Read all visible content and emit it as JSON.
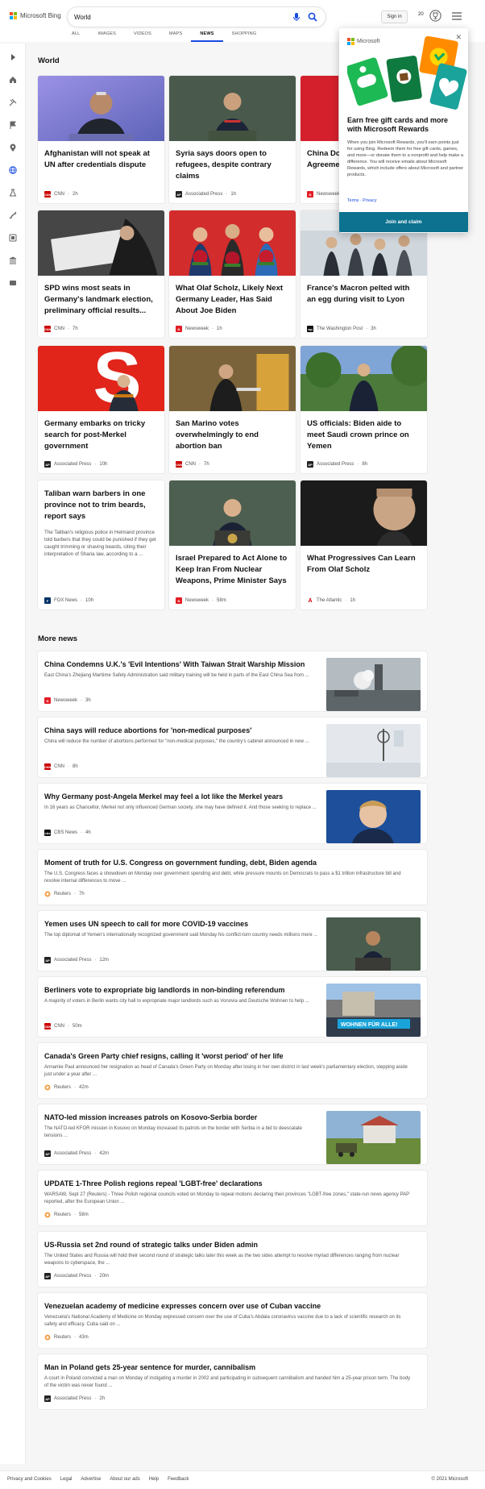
{
  "header": {
    "brand": "Microsoft Bing",
    "query": "World",
    "signin": "Sign in",
    "points": "20"
  },
  "tabs": [
    "ALL",
    "IMAGES",
    "VIDEOS",
    "MAPS",
    "NEWS",
    "SHOPPING"
  ],
  "active_tab": "NEWS",
  "section_world": "World",
  "section_more": "More news",
  "popup": {
    "brand": "Microsoft",
    "headline": "Earn free gift cards and more with Microsoft Rewards",
    "body": "When you join Microsoft Rewards, you'll earn points just for using Bing. Redeem them for free gift cards, games, and more—or donate them to a nonprofit and help make a difference. You will receive emails about Microsoft Rewards, which include offers about Microsoft and partner products.",
    "terms": "Terms",
    "privacy": "Privacy",
    "cta": "Join and claim"
  },
  "cards": [
    {
      "title": "Afghanistan will not speak at UN after credentials dispute",
      "source": "CNN",
      "time": "2h",
      "logo": "cnn",
      "img": "afghan"
    },
    {
      "title": "Syria says doors open to refugees, despite contrary claims",
      "source": "Associated Press",
      "time": "1h",
      "logo": "ap",
      "img": "syria"
    },
    {
      "title": "China Do... Prisoner... Agreeme...",
      "source": "Newsweek",
      "time": "",
      "logo": "nw",
      "img": "china"
    },
    {
      "title": "SPD wins most seats in Germany's landmark election, preliminary official results...",
      "source": "CNN",
      "time": "7h",
      "logo": "cnn",
      "img": "vote"
    },
    {
      "title": "What Olaf Scholz, Likely Next Germany Leader, Has Said About Joe Biden",
      "source": "Newsweek",
      "time": "1h",
      "logo": "nw",
      "img": "flowers"
    },
    {
      "title": "France's Macron pelted with an egg during visit to Lyon",
      "source": "The Washington Post",
      "time": "3h",
      "logo": "wp",
      "img": "macron"
    },
    {
      "title": "Germany embarks on tricky search for post-Merkel government",
      "source": "Associated Press",
      "time": "10h",
      "logo": "ap",
      "img": "spd"
    },
    {
      "title": "San Marino votes overwhelmingly to end abortion ban",
      "source": "CNN",
      "time": "7h",
      "logo": "cnn",
      "img": "sanmarino"
    },
    {
      "title": "US officials: Biden aide to meet Saudi crown prince on Yemen",
      "source": "Associated Press",
      "time": "8h",
      "logo": "ap",
      "img": "biden"
    },
    {
      "title": "Taliban warn barbers in one province not to trim beards, report says",
      "desc": "The Taliban's religious police in Helmand province told barbers that they could be punished if they get caught trimming or shaving beards, citing their interpretation of Sharia law, according to a ...",
      "source": "FOX News",
      "time": "10h",
      "logo": "fox",
      "img": ""
    },
    {
      "title": "Israel Prepared to Act Alone to Keep Iran From Nuclear Weapons, Prime Minister Says",
      "source": "Newsweek",
      "time": "58m",
      "logo": "nw",
      "img": "israel"
    },
    {
      "title": "What Progressives Can Learn From Olaf Scholz",
      "source": "The Atlantic",
      "time": "1h",
      "logo": "atl",
      "img": "scholz"
    }
  ],
  "more": [
    {
      "title": "China Condemns U.K.'s 'Evil Intentions' With Taiwan Strait Warship Mission",
      "desc": "East China's Zhejiang Maritime Safety Administration said military training will be held in parts of the East China Sea from ...",
      "source": "Newsweek",
      "time": "3h",
      "logo": "nw",
      "img": "ship"
    },
    {
      "title": "China says will reduce abortions for 'non-medical purposes'",
      "desc": "China will reduce the number of abortions performed for \"non-medical purposes,\" the country's cabinet announced in new ...",
      "source": "CNN",
      "time": "8h",
      "logo": "cnn",
      "img": "clinic"
    },
    {
      "title": "Why Germany post-Angela Merkel may feel a lot like the Merkel years",
      "desc": "In 16 years as Chancellor, Merkel not only influenced German society, she may have defined it. And those seeking to replace ...",
      "source": "CBS News",
      "time": "4h",
      "logo": "cbs",
      "img": "merkel"
    },
    {
      "title": "Moment of truth for U.S. Congress on government funding, debt, Biden agenda",
      "desc": "The U.S. Congress faces a showdown on Monday over government spending and debt, while pressure mounts on Democrats to pass a $1 trillion infrastructure bill and resolve internal differences to move ...",
      "source": "Reuters",
      "time": "7h",
      "logo": "reu",
      "img": ""
    },
    {
      "title": "Yemen uses UN speech to call for more COVID-19 vaccines",
      "desc": "The top diplomat of Yemen's internationally recognized government said Monday his conflict-torn country needs millions more ...",
      "source": "Associated Press",
      "time": "12m",
      "logo": "ap",
      "img": "yemen"
    },
    {
      "title": "Berliners vote to expropriate big landlords in non-binding referendum",
      "desc": "A majority of voters in Berlin wants city hall to expropriate major landlords such as Vonovia and Deutsche Wohnen to help ...",
      "source": "CNN",
      "time": "50m",
      "logo": "cnn",
      "img": "berlin",
      "banner": "WOHNEN FÜR ALLE!"
    },
    {
      "title": "Canada's Green Party chief resigns, calling it 'worst period' of her life",
      "desc": "Annamie Paul announced her resignation as head of Canada's Green Party on Monday after losing in her own district in last week's parliamentary election, stepping aside just under a year after ...",
      "source": "Reuters",
      "time": "42m",
      "logo": "reu",
      "img": ""
    },
    {
      "title": "NATO-led mission increases patrols on Kosovo-Serbia border",
      "desc": "The NATO-led KFOR mission in Kosovo on Monday increased its patrols on the border with Serbia in a bid to deescalate tensions ...",
      "source": "Associated Press",
      "time": "42m",
      "logo": "ap",
      "img": "kosovo"
    },
    {
      "title": "UPDATE 1-Three Polish regions repeal 'LGBT-free' declarations",
      "desc": "WARSAW, Sept 27 (Reuters) - Three Polish regional councils voted on Monday to repeal motions declaring their provinces \"LGBT-free zones,\" state-run news agency PAP reported, after the European Union ...",
      "source": "Reuters",
      "time": "58m",
      "logo": "reu",
      "img": ""
    },
    {
      "title": "US-Russia set 2nd round of strategic talks under Biden admin",
      "desc": "The United States and Russia will hold their second round of strategic talks later this week as the two sides attempt to resolve myriad differences ranging from nuclear weapons to cyberspace, the ...",
      "source": "Associated Press",
      "time": "20m",
      "logo": "ap",
      "img": ""
    },
    {
      "title": "Venezuelan academy of medicine expresses concern over use of Cuban vaccine",
      "desc": "Venezuela's National Academy of Medicine on Monday expressed concern over the use of Cuba's Abdala coronavirus vaccine due to a lack of scientific research on its safety and efficacy. Cuba said on ...",
      "source": "Reuters",
      "time": "43m",
      "logo": "reu",
      "img": ""
    },
    {
      "title": "Man in Poland gets 25-year sentence for murder, cannibalism",
      "desc": "A court in Poland convicted a man on Monday of instigating a murder in 2002 and participating in subsequent cannibalism and handed him a 25-year prison term. The body of the victim was never found ...",
      "source": "Associated Press",
      "time": "2h",
      "logo": "ap",
      "img": ""
    }
  ],
  "footer": {
    "links": [
      "Privacy and Cookies",
      "Legal",
      "Advertise",
      "About our ads",
      "Help",
      "Feedback"
    ],
    "copyright": "© 2021 Microsoft"
  },
  "colors": {
    "accent": "#174ae4",
    "cta": "#0c7290",
    "cnn": "#cc0000",
    "ap": "#222222",
    "newsweek": "#e21e26"
  }
}
